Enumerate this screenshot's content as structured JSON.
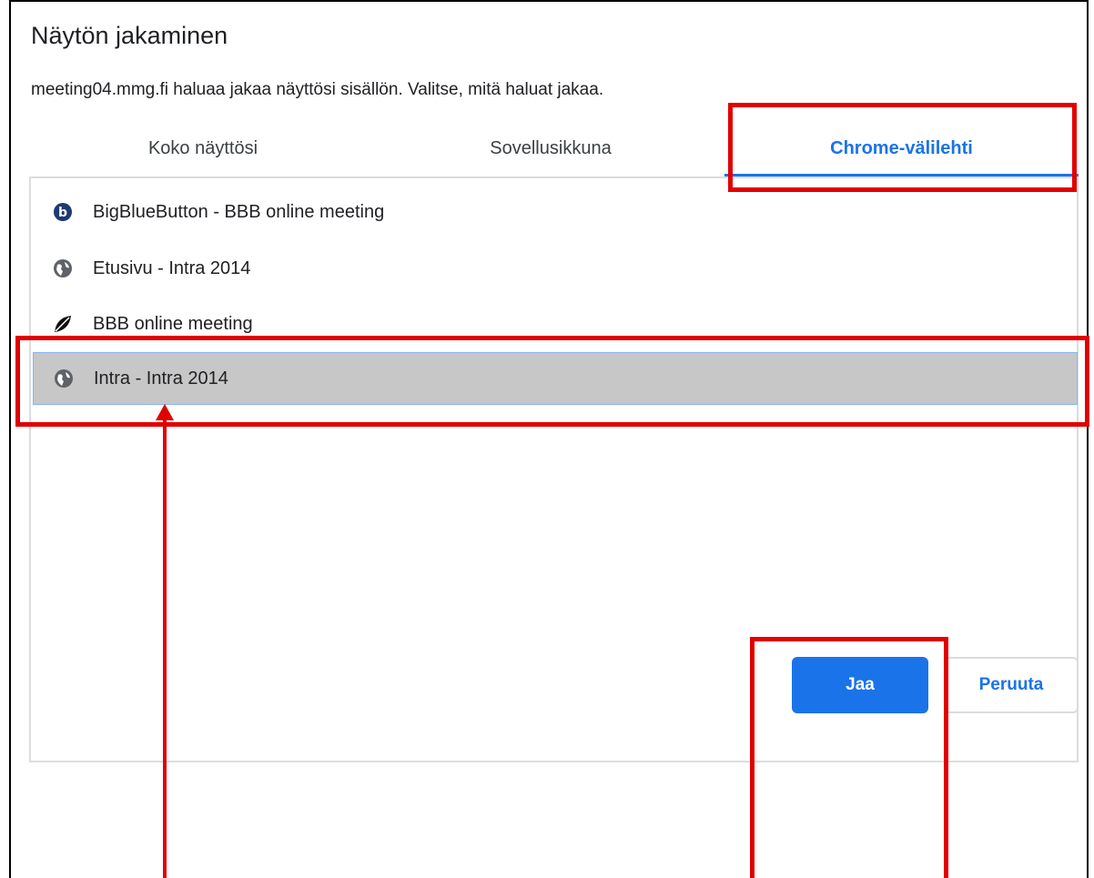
{
  "dialog": {
    "title": "Näytön jakaminen",
    "subtitle": "meeting04.mmg.fi haluaa jakaa näyttösi sisällön. Valitse, mitä haluat jakaa."
  },
  "tabs": [
    {
      "label": "Koko näyttösi",
      "active": false
    },
    {
      "label": "Sovellusikkuna",
      "active": false
    },
    {
      "label": "Chrome-välilehti",
      "active": true
    }
  ],
  "list": {
    "items": [
      {
        "label": "BigBlueButton - BBB online meeting",
        "icon": "bigbluebutton-icon",
        "selected": false
      },
      {
        "label": "Etusivu - Intra 2014",
        "icon": "globe-icon",
        "selected": false
      },
      {
        "label": "BBB online meeting",
        "icon": "leaf-icon",
        "selected": false
      },
      {
        "label": "Intra - Intra 2014",
        "icon": "globe-icon",
        "selected": true
      }
    ]
  },
  "buttons": {
    "share_label": "Jaa",
    "cancel_label": "Peruuta"
  },
  "colors": {
    "accent": "#1a73e8",
    "annotation": "#e00000",
    "selected_row": "#c7c7c7"
  }
}
